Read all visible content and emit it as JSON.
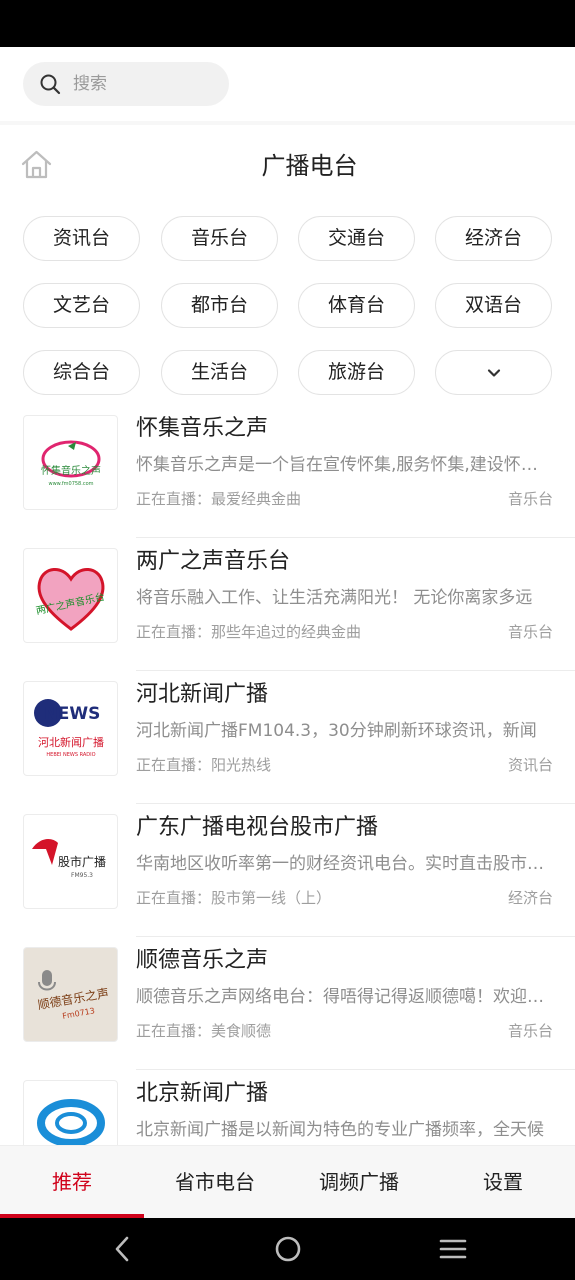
{
  "search": {
    "placeholder": "搜索"
  },
  "header": {
    "title": "广播电台"
  },
  "categories": [
    "资讯台",
    "音乐台",
    "交通台",
    "经济台",
    "文艺台",
    "都市台",
    "体育台",
    "双语台",
    "综合台",
    "生活台",
    "旅游台"
  ],
  "stations": [
    {
      "title": "怀集音乐之声",
      "desc": "怀集音乐之声是一个旨在宣传怀集,服务怀集,建设怀集的电台",
      "live": "正在直播：最爱经典金曲",
      "category": "音乐台",
      "logo_text": "怀集音乐之声",
      "logo_sub": "www.fm0758.com"
    },
    {
      "title": "两广之声音乐台",
      "desc": "将音乐融入工作、让生活充满阳光！ 无论你离家多远",
      "live": "正在直播：那些年追过的经典金曲",
      "category": "音乐台",
      "logo_text": "两广之声音乐台"
    },
    {
      "title": "河北新闻广播",
      "desc": "河北新闻广播FM104.3，30分钟刷新环球资讯，新闻",
      "live": "正在直播：阳光热线",
      "category": "资讯台",
      "logo_text": "NEWS",
      "logo_sub": "河北新闻广播",
      "logo_sub2": "HEBEI NEWS RADIO"
    },
    {
      "title": "广东广播电视台股市广播",
      "desc": "华南地区收听率第一的财经资讯电台。实时直击股市行情",
      "live": "正在直播：股市第一线（上）",
      "category": "经济台",
      "logo_text": "股市广播",
      "logo_sub": "FM95.3"
    },
    {
      "title": "顺德音乐之声",
      "desc": "顺德音乐之声网络电台：得唔得记得返顺德噶！欢迎收听",
      "live": "正在直播：美食顺德",
      "category": "音乐台",
      "logo_text": "顺德音乐之声",
      "logo_sub": "Fm0713"
    },
    {
      "title": "北京新闻广播",
      "desc": "北京新闻广播是以新闻为特色的专业广播频率，全天候",
      "live": "",
      "category": ""
    }
  ],
  "tabs": [
    {
      "label": "推荐",
      "active": true
    },
    {
      "label": "省市电台",
      "active": false
    },
    {
      "label": "调频广播",
      "active": false
    },
    {
      "label": "设置",
      "active": false
    }
  ],
  "colors": {
    "accent": "#d0021b",
    "chip_border": "#e3e3e3",
    "muted_text": "#8e8e8e"
  }
}
